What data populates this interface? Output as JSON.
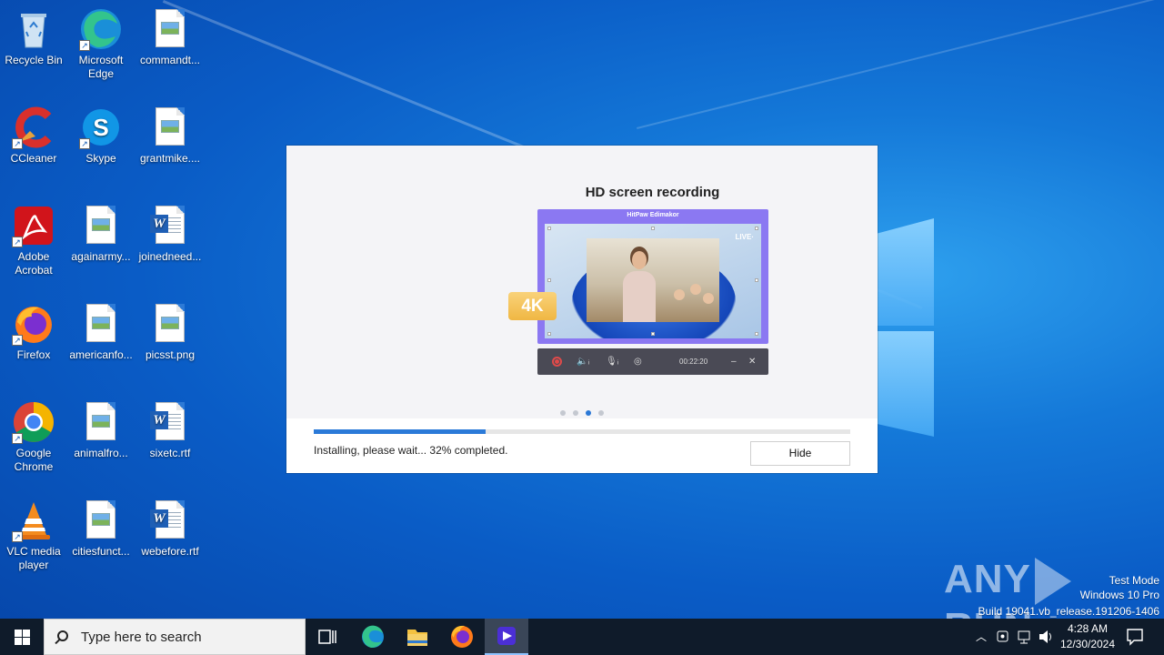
{
  "desktop": {
    "icons": [
      {
        "label": "Recycle Bin"
      },
      {
        "label": "Microsoft Edge"
      },
      {
        "label": "commandt..."
      },
      {
        "label": "CCleaner"
      },
      {
        "label": "Skype"
      },
      {
        "label": "grantmike...."
      },
      {
        "label": "Adobe Acrobat"
      },
      {
        "label": "againarmy..."
      },
      {
        "label": "joinedneed..."
      },
      {
        "label": "Firefox"
      },
      {
        "label": "americanfo..."
      },
      {
        "label": "picsst.png"
      },
      {
        "label": "Google Chrome"
      },
      {
        "label": "animalfro..."
      },
      {
        "label": "sixetc.rtf"
      },
      {
        "label": "VLC media player"
      },
      {
        "label": "citiesfunct..."
      },
      {
        "label": "webefore.rtf"
      }
    ]
  },
  "installer": {
    "slide_title": "HD screen recording",
    "preview_app_title": "HitPaw Edimakor",
    "live_label": "LIVE·",
    "badge": "4K",
    "timer": "00:22:20",
    "slide_count": 4,
    "active_slide": 3,
    "progress": 0.32,
    "status": "Installing, please wait... 32% completed.",
    "hide_label": "Hide"
  },
  "watermark": {
    "brand_left": "ANY",
    "brand_right": "RUN",
    "line1": "Test Mode",
    "line2": "Windows 10 Pro",
    "line3": "Build 19041.vb_release.191206-1406"
  },
  "taskbar": {
    "search_placeholder": "Type here to search",
    "time": "4:28 AM",
    "date": "12/30/2024"
  },
  "colors": {
    "accent": "#2b7ad8",
    "badge": "#f0b743",
    "preview_frame": "#8b78f2"
  }
}
